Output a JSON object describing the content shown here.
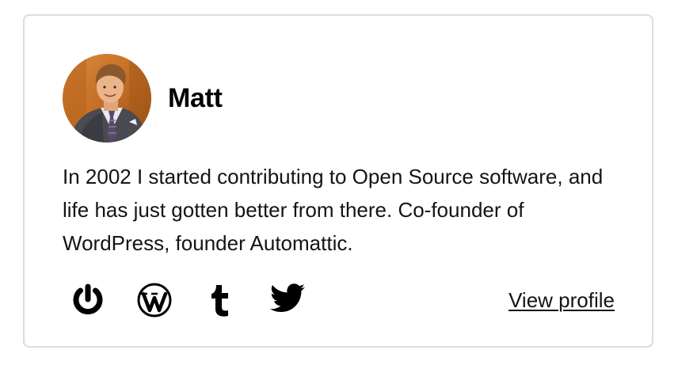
{
  "profile": {
    "name": "Matt",
    "bio": "In 2002 I started contributing to Open Source software, and life has just gotten better from there. Co-founder of WordPress, founder Automattic.",
    "avatar_icon": "user-photo-avatar",
    "view_profile_label": "View profile"
  },
  "social": [
    {
      "icon": "gravatar-icon"
    },
    {
      "icon": "wordpress-icon"
    },
    {
      "icon": "tumblr-icon"
    },
    {
      "icon": "twitter-icon"
    }
  ],
  "colors": {
    "border": "#dcdcde",
    "text": "#101517",
    "icon": "#000000",
    "avatar_background": "#c9762c"
  }
}
